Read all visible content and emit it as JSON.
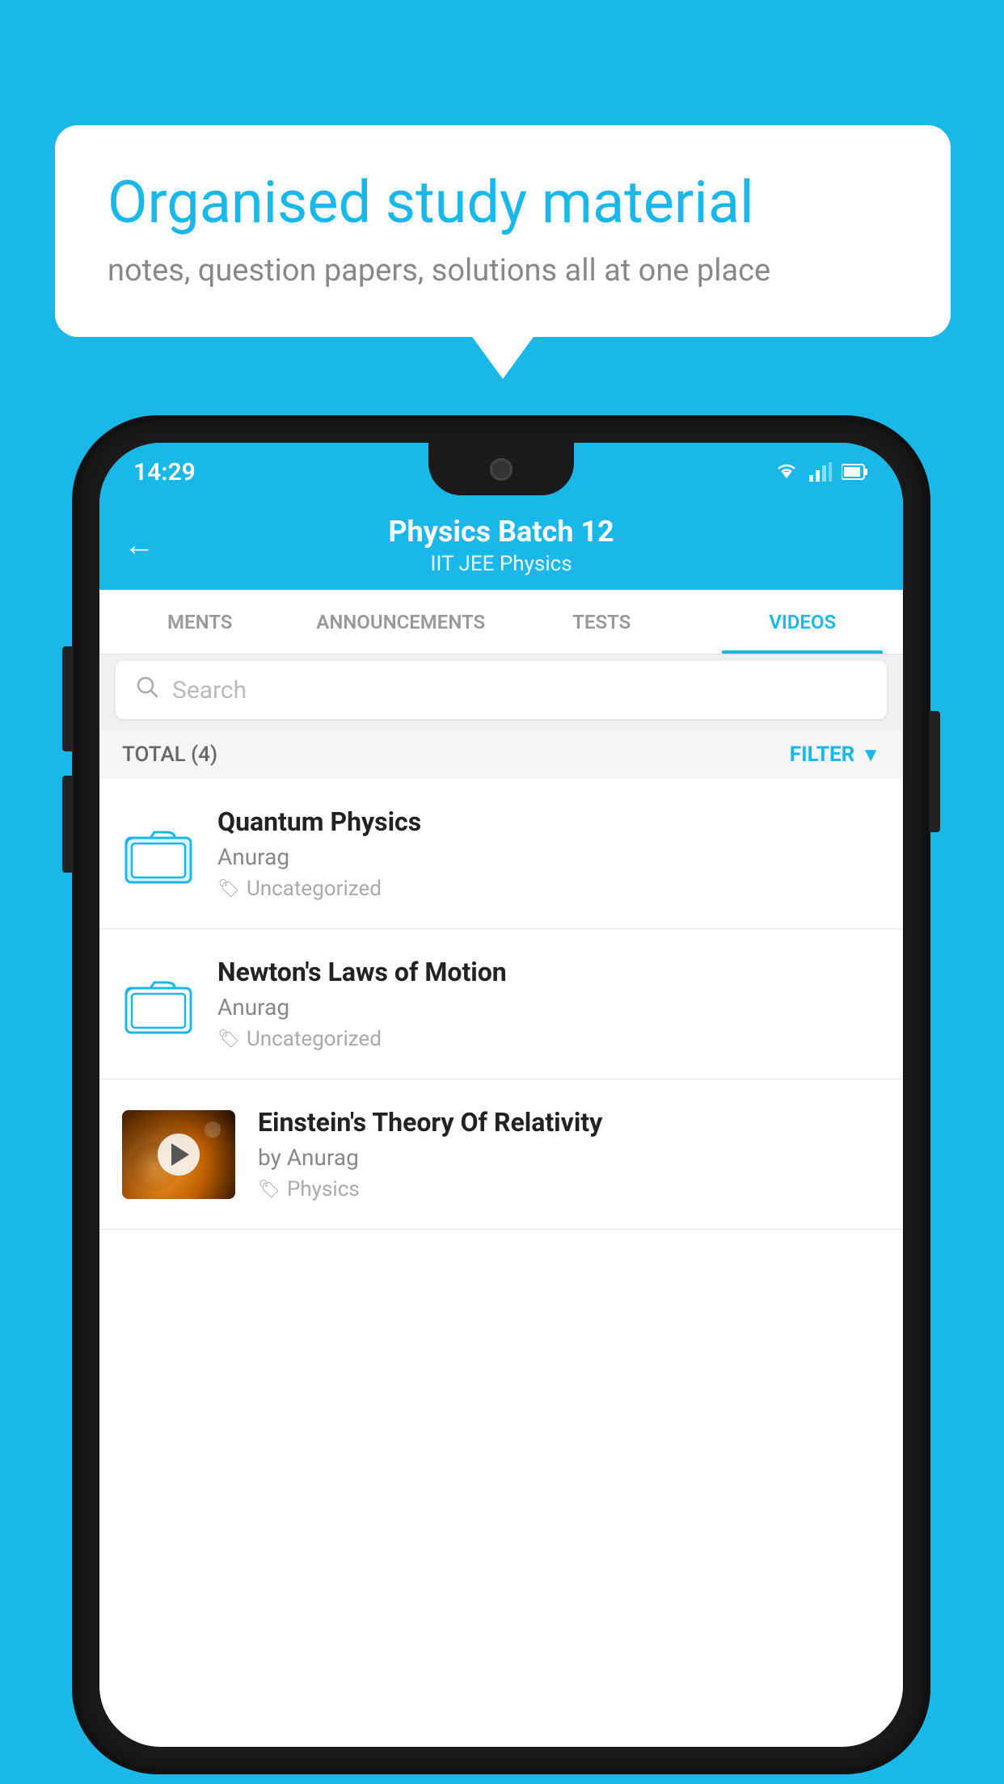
{
  "background_color": "#1ab8e8",
  "bubble": {
    "title": "Organised study material",
    "subtitle": "notes, question papers, solutions all at one place"
  },
  "status_bar": {
    "time": "14:29"
  },
  "header": {
    "title": "Physics Batch 12",
    "subtitle": "IIT JEE   Physics",
    "back_label": "←"
  },
  "tabs": [
    {
      "label": "MENTS",
      "active": false
    },
    {
      "label": "ANNOUNCEMENTS",
      "active": false
    },
    {
      "label": "TESTS",
      "active": false
    },
    {
      "label": "VIDEOS",
      "active": true
    }
  ],
  "search": {
    "placeholder": "Search"
  },
  "filter_bar": {
    "total_label": "TOTAL (4)",
    "filter_label": "FILTER"
  },
  "videos": [
    {
      "id": 1,
      "title": "Quantum Physics",
      "author": "Anurag",
      "tag": "Uncategorized",
      "type": "folder",
      "has_thumbnail": false
    },
    {
      "id": 2,
      "title": "Newton's Laws of Motion",
      "author": "Anurag",
      "tag": "Uncategorized",
      "type": "folder",
      "has_thumbnail": false
    },
    {
      "id": 3,
      "title": "Einstein's Theory Of Relativity",
      "author": "by Anurag",
      "tag": "Physics",
      "type": "video",
      "has_thumbnail": true
    }
  ]
}
